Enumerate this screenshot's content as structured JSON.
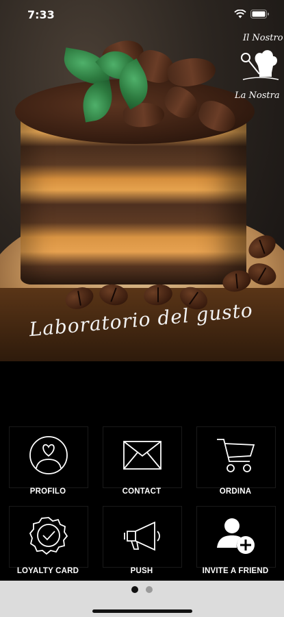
{
  "status_bar": {
    "time": "7:33"
  },
  "hero": {
    "title": "Laboratorio del gusto",
    "logo_text_top": "Il Nostro",
    "logo_text_bottom": "La Nostra"
  },
  "tiles": [
    {
      "label": "PROFILO",
      "icon": "profile-heart-icon"
    },
    {
      "label": "CONTACT",
      "icon": "envelope-icon"
    },
    {
      "label": "ORDINA",
      "icon": "shopping-cart-icon"
    },
    {
      "label": "LOYALTY CARD",
      "icon": "loyalty-badge-icon"
    },
    {
      "label": "PUSH",
      "icon": "megaphone-icon"
    },
    {
      "label": "INVITE A FRIEND",
      "icon": "add-user-icon"
    }
  ],
  "pager": {
    "page_count": 2,
    "active_index": 0
  },
  "colors": {
    "background": "#000000",
    "tile_border": "#1a1a1a",
    "pager_bar": "#dcdcdc",
    "dot_active": "#111111",
    "dot_inactive": "#9a9a9a"
  }
}
